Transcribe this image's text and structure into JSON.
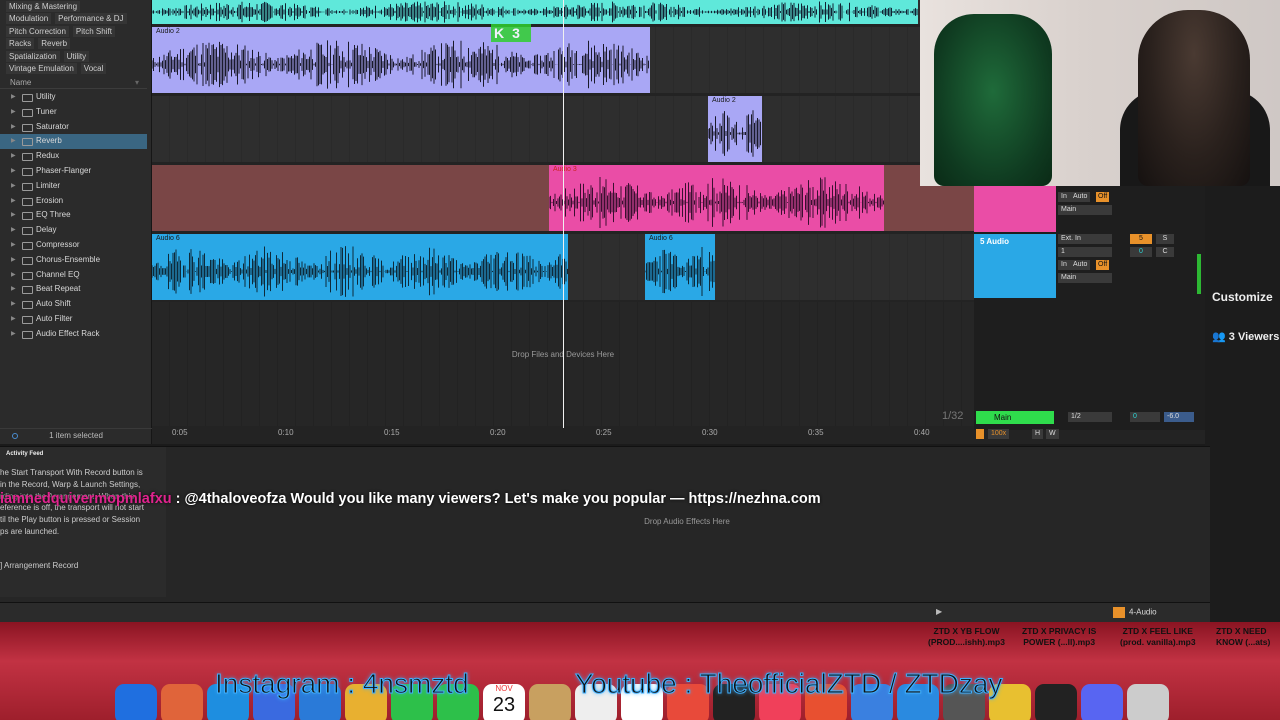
{
  "browser": {
    "tags": [
      [
        "Mixing & Mastering"
      ],
      [
        "Modulation",
        "Performance & DJ"
      ],
      [
        "Pitch Correction",
        "Pitch Shift"
      ],
      [
        "Racks",
        "Reverb"
      ],
      [
        "Spatialization",
        "Utility"
      ],
      [
        "Vintage Emulation",
        "Vocal"
      ]
    ],
    "column_header": "Name",
    "folders": [
      "Utility",
      "Tuner",
      "Saturator",
      "Reverb",
      "Redux",
      "Phaser-Flanger",
      "Limiter",
      "Erosion",
      "EQ Three",
      "Delay",
      "Compressor",
      "Chorus-Ensemble",
      "Channel EQ",
      "Beat Repeat",
      "Auto Shift",
      "Auto Filter",
      "Audio Effect Rack"
    ],
    "selected_folder": "Reverb",
    "selection_count": "1 item selected"
  },
  "arrangement": {
    "clips": {
      "audio2_a": "Audio 2",
      "audio2_b": "Audio 2",
      "audio3": "Audio 3",
      "audio6_a": "Audio 6",
      "audio6_b": "Audio 6"
    },
    "drop_files": "Drop Files and Devices Here",
    "key_overlay": {
      "key": "K",
      "count": "3"
    },
    "ratio": "1/32",
    "ruler_ticks": [
      "0:05",
      "0:10",
      "0:15",
      "0:20",
      "0:25",
      "0:30",
      "0:35",
      "0:40"
    ],
    "colors": {
      "cyan": "#5fe8da",
      "lavender": "#a9a7f5",
      "pink": "#ea4da6",
      "dark_red": "#7a4646",
      "blue": "#2aa8e6",
      "green": "#2fdc4c",
      "orange": "#e8912a"
    }
  },
  "mixer": {
    "track3": {
      "io": {
        "auto": "Auto",
        "off": "Off",
        "in": "In",
        "out": "Main"
      }
    },
    "track5": {
      "name": "5 Audio",
      "input": "Ext. In",
      "channel": "1",
      "auto": "Auto",
      "off": "Off",
      "in": "In",
      "out": "Main",
      "number": "5",
      "solo": "S",
      "vol": "0",
      "pan": "C"
    },
    "main": {
      "name": "Main",
      "ratio": "1/2",
      "vol": "0",
      "db": "-6.0"
    },
    "zoom": "100x",
    "hw": [
      "H",
      "W"
    ]
  },
  "detail": {
    "activity_title": "Activity Feed",
    "help_lines": [
      "he Start Transport With Record button is",
      " in the Record, Warp & Launch Settings,",
      "rding into the Arrangement. When this",
      "eference is off, the transport will not start",
      "til the Play button is pressed or Session",
      "ps are launched."
    ],
    "help_footer": "] Arrangement Record",
    "drop_effects": "Drop Audio Effects Here",
    "track_name": "4-Audio"
  },
  "chat": {
    "user": "iamnedquivermopmlafxu",
    "message": ": @4thaloveofza Would you like many viewers? Let's make you popular — https://nezhna.com"
  },
  "stream": {
    "customize": "Customize",
    "viewers": "3 Viewers"
  },
  "desktop_files": [
    "ZTD X YB FLOW\n(PROD....ishh).mp3",
    "ZTD X PRIVACY IS\nPOWER (...ll).mp3",
    "ZTD X FEEL LIKE\n(prod. vanilla).mp3",
    "ZTD X NEED\nKNOW (...ats)"
  ],
  "overlay_text": {
    "instagram": "Instagram : 4nsmztd",
    "youtube": "Youtube : TheofficialZTD / ZTDzay"
  },
  "dock": {
    "calendar_month": "NOV",
    "calendar_day": "23"
  }
}
